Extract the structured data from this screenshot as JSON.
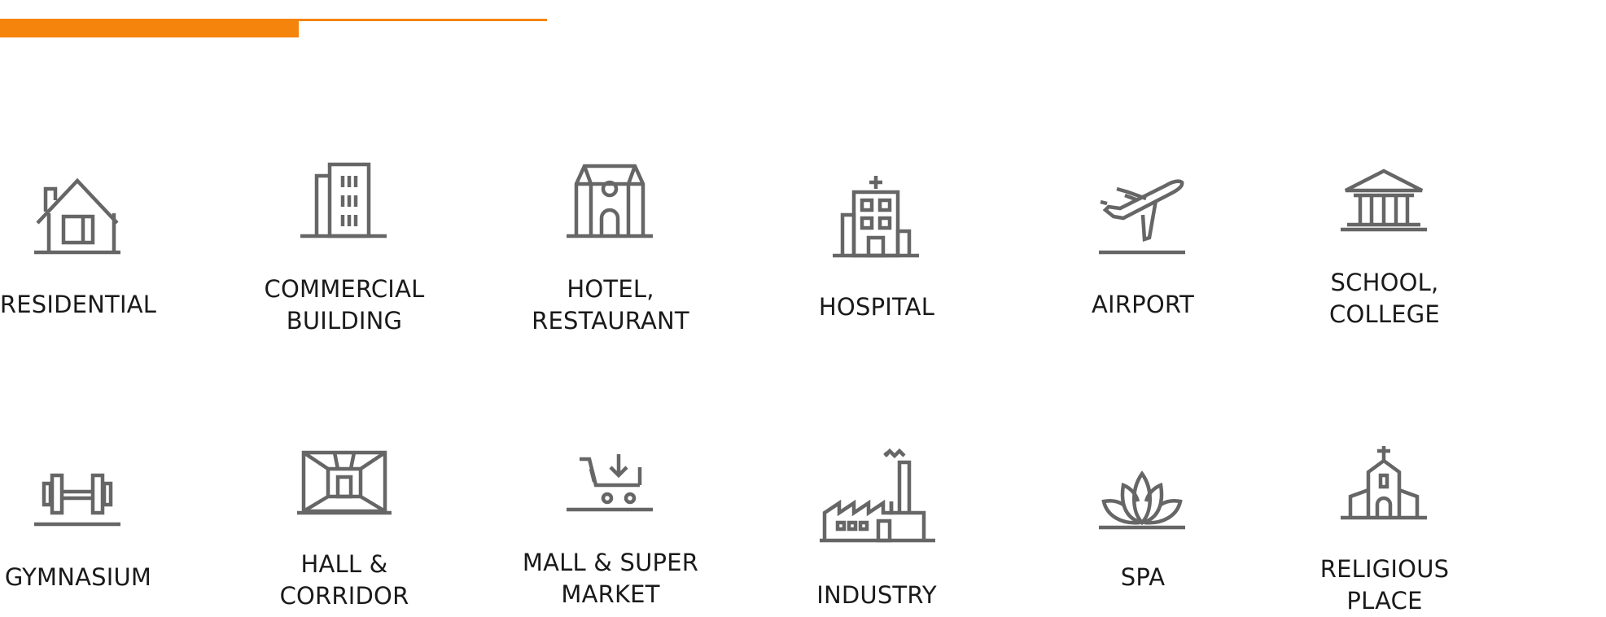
{
  "theme": {
    "accent": "#f5840c",
    "icon_color": "#666666",
    "text_color": "#1a1a1a"
  },
  "tiles": [
    {
      "icon": "house-icon",
      "label": [
        "RESIDENTIAL"
      ]
    },
    {
      "icon": "office-building-icon",
      "label": [
        "COMMERCIAL",
        "BUILDING"
      ]
    },
    {
      "icon": "hotel-icon",
      "label": [
        "HOTEL,",
        "RESTAURANT"
      ]
    },
    {
      "icon": "hospital-icon",
      "label": [
        "HOSPITAL"
      ]
    },
    {
      "icon": "airplane-icon",
      "label": [
        "AIRPORT"
      ]
    },
    {
      "icon": "school-icon",
      "label": [
        "SCHOOL,",
        "COLLEGE"
      ]
    },
    {
      "icon": "dumbbell-icon",
      "label": [
        "GYMNASIUM"
      ]
    },
    {
      "icon": "hall-corridor-icon",
      "label": [
        "HALL &",
        "CORRIDOR"
      ]
    },
    {
      "icon": "shopping-cart-icon",
      "label": [
        "MALL & SUPER",
        "MARKET"
      ]
    },
    {
      "icon": "factory-icon",
      "label": [
        "INDUSTRY"
      ]
    },
    {
      "icon": "lotus-icon",
      "label": [
        "SPA"
      ]
    },
    {
      "icon": "church-icon",
      "label": [
        "RELIGIOUS",
        "PLACE"
      ]
    }
  ]
}
